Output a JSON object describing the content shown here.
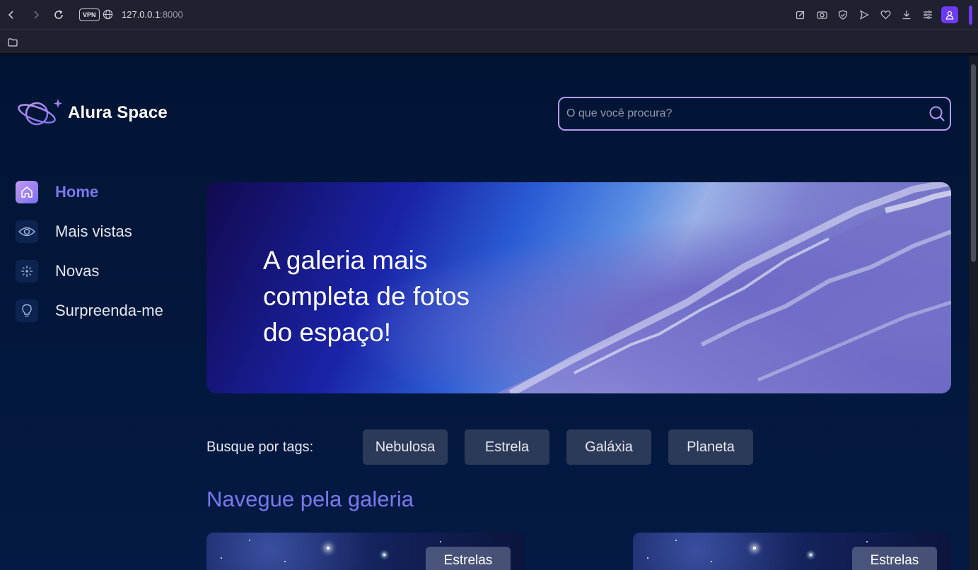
{
  "browser": {
    "vpn_label": "VPN",
    "url_host": "127.0.0.1",
    "url_port": ":8000"
  },
  "app": {
    "logo_text": "Alura Space",
    "search_placeholder": "O que você procura?"
  },
  "sidebar": {
    "items": [
      {
        "label": "Home",
        "icon": "home-icon",
        "active": true
      },
      {
        "label": "Mais vistas",
        "icon": "eye-icon",
        "active": false
      },
      {
        "label": "Novas",
        "icon": "sparkle-icon",
        "active": false
      },
      {
        "label": "Surpreenda-me",
        "icon": "lightbulb-icon",
        "active": false
      }
    ]
  },
  "banner": {
    "text": "A galeria mais completa de fotos do espaço!"
  },
  "tags": {
    "label": "Busque por tags:",
    "items": [
      "Nebulosa",
      "Estrela",
      "Galáxia",
      "Planeta"
    ]
  },
  "gallery": {
    "title": "Navegue pela galeria",
    "cards": [
      {
        "tag": "Estrelas"
      },
      {
        "tag": "Estrelas"
      }
    ]
  },
  "colors": {
    "accent": "#7b78ee",
    "background": "#041230",
    "tag_bg": "#2b3a58",
    "search_border": "#b59af5"
  }
}
